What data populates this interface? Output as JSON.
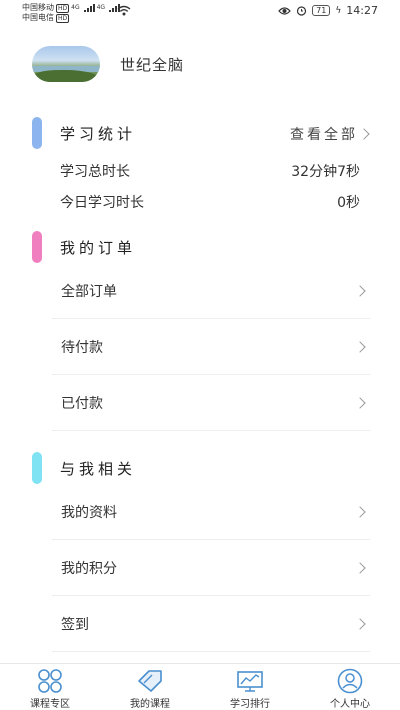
{
  "status_bar": {
    "carrier1": "中国移动",
    "carrier2": "中国电信",
    "hd": "HD",
    "net": "4G",
    "battery": "71",
    "time": "14:27"
  },
  "profile": {
    "username": "世纪全脑"
  },
  "study_stats": {
    "title": "学习统计",
    "view_all": "查看全部",
    "total_label": "学习总时长",
    "total_value": "32分钟7秒",
    "today_label": "今日学习时长",
    "today_value": "0秒"
  },
  "orders": {
    "title": "我的订单",
    "items": [
      "全部订单",
      "待付款",
      "已付款"
    ]
  },
  "related": {
    "title": "与我相关",
    "items": [
      "我的资料",
      "我的积分",
      "签到"
    ]
  },
  "tabbar": {
    "tabs": [
      "课程专区",
      "我的课程",
      "学习排行",
      "个人中心"
    ]
  },
  "colors": {
    "stats_accent": "#8cb4ee",
    "orders_accent": "#f07fbf",
    "related_accent": "#7fe3f3",
    "tab_icon": "#4a8fcf"
  }
}
